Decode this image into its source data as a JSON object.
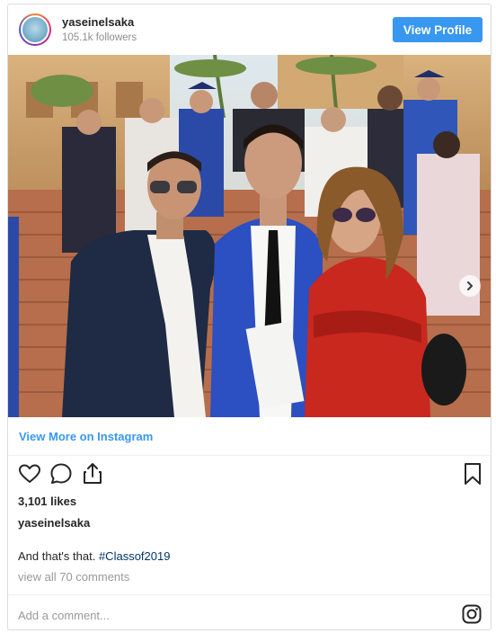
{
  "header": {
    "username": "yaseinelsaka",
    "followers": "105.1k followers",
    "view_profile_label": "View Profile"
  },
  "photo": {
    "icons": [
      "carousel-next-icon"
    ]
  },
  "view_more_label": "View More on Instagram",
  "actions": {
    "icons": [
      "heart-icon",
      "comment-icon",
      "share-icon",
      "bookmark-icon"
    ]
  },
  "likes": "3,101 likes",
  "owner": "yaseinelsaka",
  "caption": {
    "text": "And that's that.",
    "hashtag": "#Classof2019"
  },
  "comments_link": "view all 70 comments",
  "footer": {
    "add_comment_placeholder": "Add a comment...",
    "icon": "instagram-icon"
  },
  "colors": {
    "accent": "#3897f0",
    "hashtag": "#003569",
    "muted": "#999999",
    "border": "#dbdbdb"
  }
}
